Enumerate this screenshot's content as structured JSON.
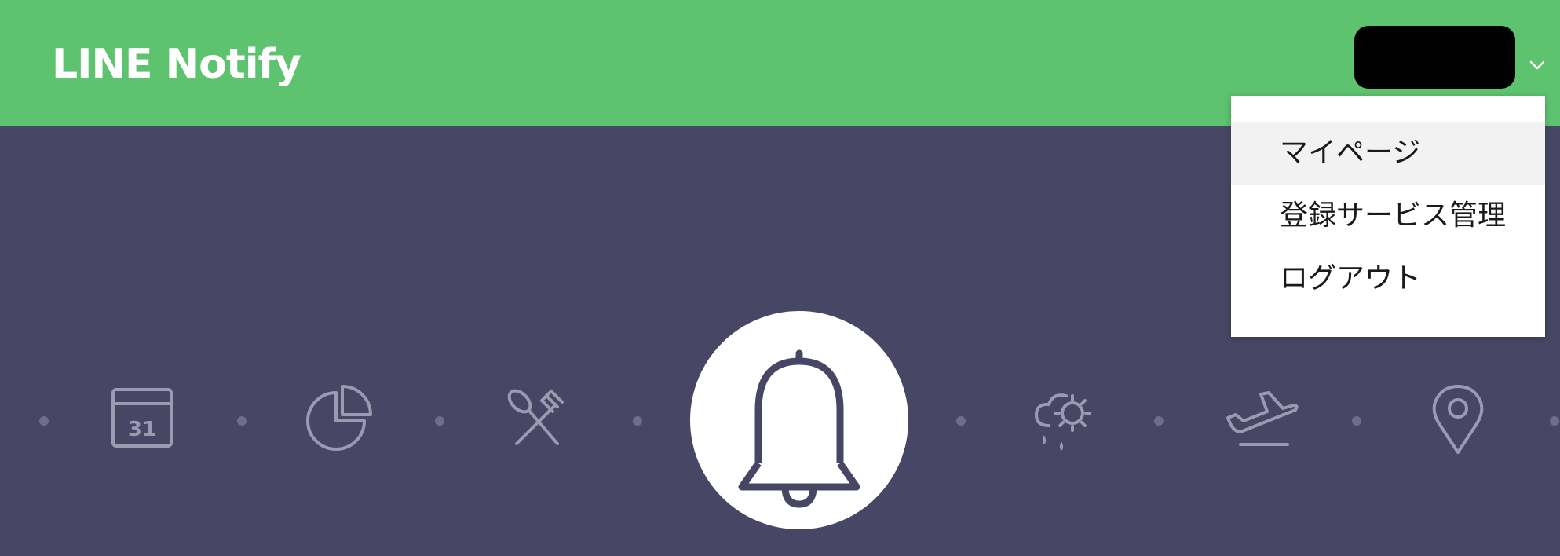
{
  "header": {
    "logo_text": "LINE Notify",
    "account_menu_icon": "chevron-down-icon"
  },
  "dropdown": {
    "items": [
      {
        "label": "マイページ",
        "active": true
      },
      {
        "label": "登録サービス管理",
        "active": false
      },
      {
        "label": "ログアウト",
        "active": false
      }
    ]
  },
  "hero": {
    "calendar_number": "31",
    "icons": [
      "calendar-icon",
      "pie-chart-icon",
      "utensils-icon",
      "bell-icon",
      "weather-icon",
      "airplane-icon",
      "location-pin-icon"
    ]
  },
  "colors": {
    "header": "#5ec36f",
    "hero_background": "#474765",
    "icon_stroke": "#9a9ab0",
    "bell_stroke": "#474765"
  }
}
